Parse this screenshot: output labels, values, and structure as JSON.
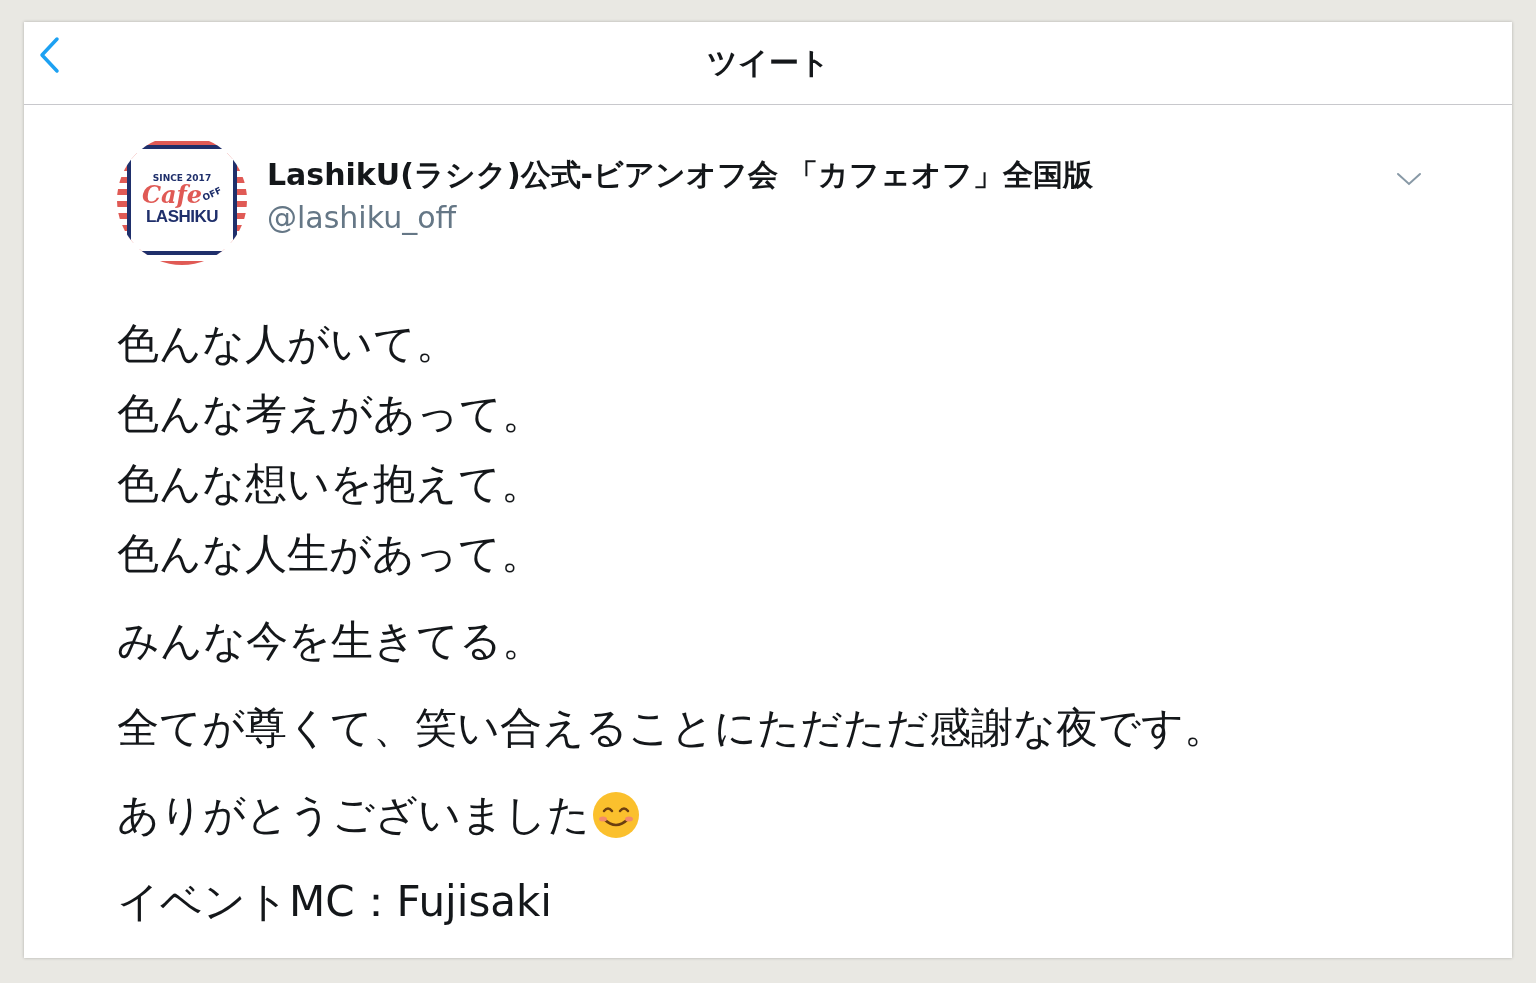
{
  "header": {
    "title": "ツイート"
  },
  "tweet": {
    "author": {
      "name": "LashikU(ラシク)公式-ビアンオフ会 「カフェオフ」全国版",
      "handle": "@lashiku_off",
      "avatar": {
        "since": "SINCE 2017",
        "script": "Cafe",
        "off": "OFF",
        "brand": "LASHIKU"
      }
    },
    "paragraphs": [
      {
        "lines": [
          "色んな人がいて。",
          "色んな考えがあって。",
          "色んな想いを抱えて。",
          "色んな人生があって。"
        ]
      },
      {
        "lines": [
          "みんな今を生きてる。"
        ]
      },
      {
        "lines": [
          "全てが尊くて、笑い合えることにただただ感謝な夜です。"
        ]
      },
      {
        "kind": "emoji-end",
        "lines": [
          "ありがとうございました"
        ]
      },
      {
        "lines": [
          "イベントMC：Fujisaki"
        ]
      }
    ]
  }
}
